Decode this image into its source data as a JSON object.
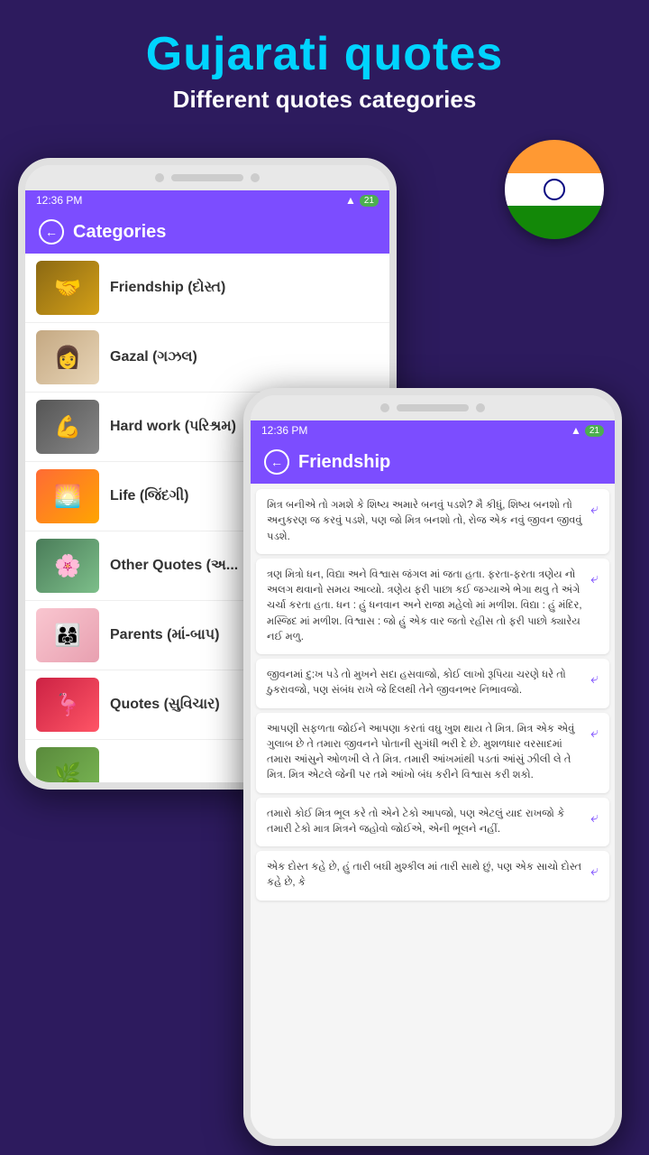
{
  "header": {
    "title": "Gujarati quotes",
    "subtitle": "Different quotes categories"
  },
  "status_bar": {
    "time": "12:36 PM",
    "wifi": "WiFi",
    "battery": "21"
  },
  "phone1": {
    "screen_title": "Categories",
    "categories": [
      {
        "id": "friendship",
        "label": "Friendship (દોસ્ત)",
        "emoji": "🤝"
      },
      {
        "id": "gazal",
        "label": "Gazal (ગઝલ)",
        "emoji": "👩"
      },
      {
        "id": "hardwork",
        "label": "Hard work (પરિશ્રમ)",
        "emoji": "💪"
      },
      {
        "id": "life",
        "label": "Life (જિંદગી)",
        "emoji": "🌅"
      },
      {
        "id": "other",
        "label": "Other Quotes (અ...",
        "emoji": "🌸"
      },
      {
        "id": "parents",
        "label": "Parents (માં-બાપ)",
        "emoji": "👨‍👩‍👧"
      },
      {
        "id": "quotes",
        "label": "Quotes (સુવિચાર)",
        "emoji": "🦩"
      },
      {
        "id": "last",
        "label": "",
        "emoji": "🌿"
      }
    ]
  },
  "phone2": {
    "screen_title": "Friendship",
    "quotes": [
      {
        "id": 1,
        "text": "મિત્ર બનીએ તો ગમશે કે શિષ્ય અમારે બનવું પડશે?\nમૈ કીધું, શિષ્ય બનશો તો અનુકરણ જ કરવું પડશે,\nપણ જો મિત્ર બનશો તો, રોજ એક નવું જીવન જીવવું પડશે."
      },
      {
        "id": 2,
        "text": "ત્રણ મિત્રો ધન, વિદ્યા અને વિશ્વાસ જંગલ માં જતા હતા.\nફરતા-ફરતા ત્રણેય નો અલગ થવાનો સમય આવ્યો.\nત્રણેય ફરી પાછા કઈ જગ્યાએ ભેગા થવુ તે અંગે ચર્ચા કરતા હતા.\nધન : હું ધનવાન અને રાજા મહેલો માં મળીશ.\nવિદ્યા : હું મંદિર, મસ્જિદ માં મળીશ.\nવિશ્વાસ : જો હું એક વાર જતો રહીસ તો ફરી પાછો ક્યારેય નઈ મળુ."
      },
      {
        "id": 3,
        "text": "જીવનમાં દુ:ખ પડે તો મુખને સદા હસવાજો,\nકોઈ લાખો રૂપિયા ચરણે ધરે તો ઠુકરાવજો,\nપણ સંબંધ રાખે જે દિલથી તેને જીવનભર નિભાવજો."
      },
      {
        "id": 4,
        "text": "આપણી સફળતા જોઈને આપણા કરતાં વઘુ ખુશ થાય તે મિત્ર. મિત્ર એક એવું ગુલાબ છે તે તમારા જીવનને પોતાની સુગંધી ભરી દે છે. મુશળધાર વરસાદમાં તમારા આંસુને ઓળખી લે તે મિત્ર. તમારી આંખમાંથી પડતાં આંસું ઝીલી લે તે મિત્ર. મિત્ર એટલે જેની પર તમે આંખો બંધ કરીને વિશ્વાસ કરી શકો."
      },
      {
        "id": 5,
        "text": "તમારો કોઈ મિત્ર ભૂલ કરે તો એને ટેકો આપજો, પણ એટલું યાદ રાખજો કે તમારી ટેકો માત્ર મિત્રને જહોવો જોઈએ, એની ભૂલને નહીં."
      },
      {
        "id": 6,
        "text": "એક દોસ્ત કહે છે,\nહું તારી બઘી મુશ્કીલ માં તારી સાથે છું,\nપણ એક સાચો દોસ્ત કહે છે, કે"
      }
    ]
  }
}
